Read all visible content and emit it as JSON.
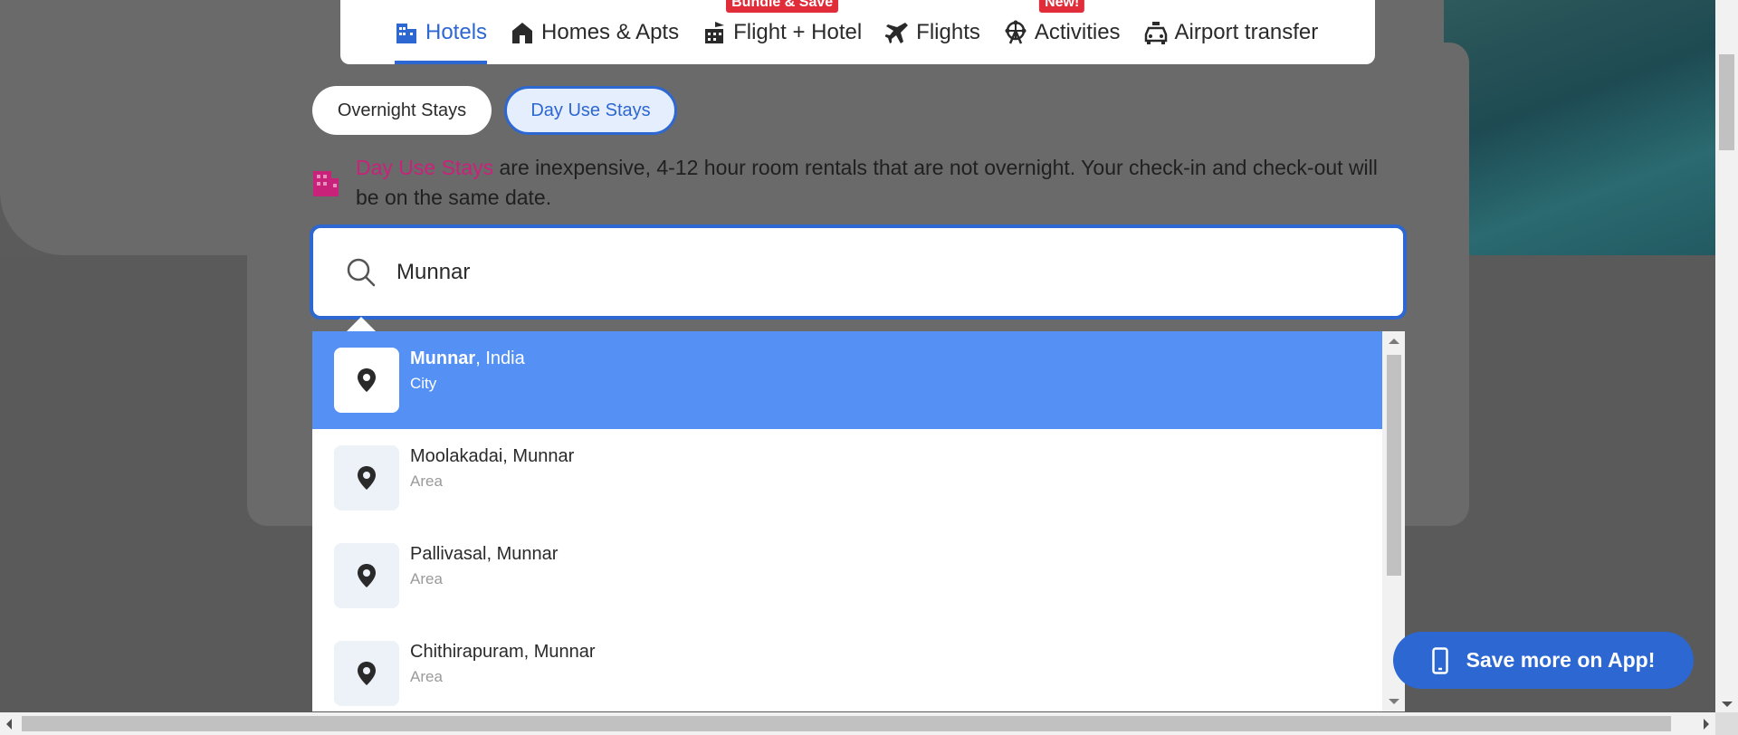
{
  "colors": {
    "accent": "#2c67d2",
    "highlight_pink": "#c9227a",
    "badge_red": "#e12d39",
    "selected_row": "#5591f5"
  },
  "nav": {
    "items": [
      {
        "label": "Hotels",
        "icon": "hotel-icon",
        "active": true,
        "badge": ""
      },
      {
        "label": "Homes & Apts",
        "icon": "home-icon",
        "active": false,
        "badge": ""
      },
      {
        "label": "Flight + Hotel",
        "icon": "flight-hotel-icon",
        "active": false,
        "badge": "Bundle & Save"
      },
      {
        "label": "Flights",
        "icon": "plane-icon",
        "active": false,
        "badge": ""
      },
      {
        "label": "Activities",
        "icon": "ferris-wheel-icon",
        "active": false,
        "badge": "New!"
      },
      {
        "label": "Airport transfer",
        "icon": "car-icon",
        "active": false,
        "badge": ""
      }
    ]
  },
  "stay_toggle": {
    "overnight_label": "Overnight Stays",
    "dayuse_label": "Day Use Stays",
    "selected": "Day Use Stays"
  },
  "info": {
    "highlight": "Day Use Stays",
    "text": " are inexpensive, 4-12 hour room rentals that are not overnight. Your check-in and check-out will be on the same date."
  },
  "search": {
    "value": "Munnar",
    "icon": "search-icon"
  },
  "suggestions": [
    {
      "name_bold": "Munnar",
      "name_rest": ", India",
      "type": "City",
      "selected": true,
      "bold_first": true
    },
    {
      "name_bold": "Moolakadai",
      "name_rest": "Munnar",
      "type": "Area",
      "selected": false,
      "bold_first": false
    },
    {
      "name_bold": "Pallivasal",
      "name_rest": "Munnar",
      "type": "Area",
      "selected": false,
      "bold_first": false
    },
    {
      "name_bold": "Chithirapuram",
      "name_rest": "Munnar",
      "type": "Area",
      "selected": false,
      "bold_first": false
    }
  ],
  "app_button": {
    "label": "Save more on App!",
    "icon": "phone-icon"
  }
}
